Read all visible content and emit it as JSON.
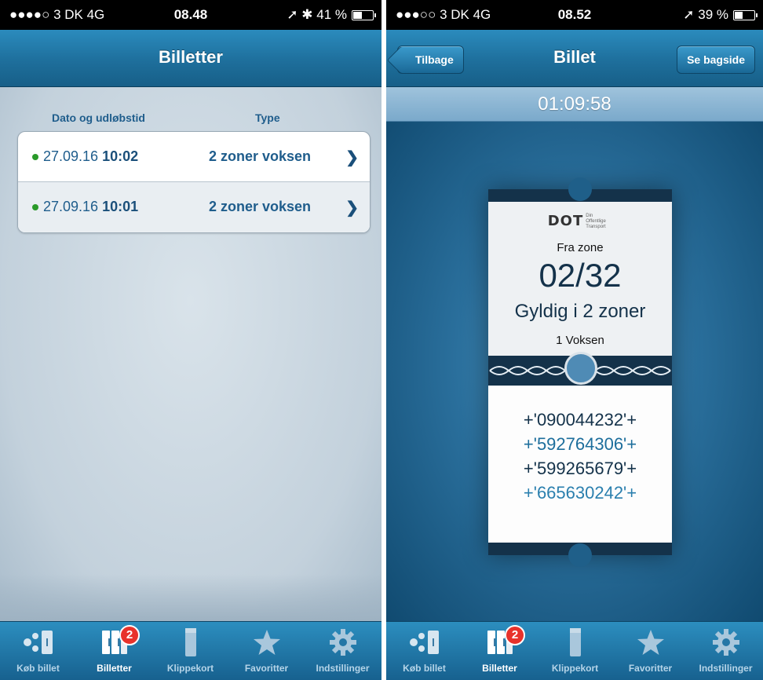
{
  "left": {
    "status": {
      "carrier": "●●●●○ 3 DK  4G",
      "time": "08.48",
      "right": "➚ ✱  41 %",
      "battery_level": 0.41
    },
    "nav": {
      "title": "Billetter"
    },
    "columns": {
      "date": "Dato og udløbstid",
      "type": "Type"
    },
    "tickets": [
      {
        "date": "27.09.16",
        "time": "10:02",
        "type": "2 zoner voksen"
      },
      {
        "date": "27.09.16",
        "time": "10:01",
        "type": "2 zoner voksen"
      }
    ]
  },
  "right": {
    "status": {
      "carrier": "●●●○○ 3 DK  4G",
      "time": "08.52",
      "right": "➚  39 %",
      "battery_level": 0.39
    },
    "nav": {
      "back": "Tilbage",
      "title": "Billet",
      "action": "Se bagside"
    },
    "timer": "01:09:58",
    "ticket": {
      "logo": "DOT",
      "logo_sub": "Din Offentlige Transport",
      "from_label": "Fra zone",
      "zone": "02/32",
      "valid": "Gyldig i 2 zoner",
      "passengers": "1 Voksen",
      "codes": [
        "+'090044232'+",
        "+'592764306'+",
        "+'599265679'+",
        "+'665630242'+"
      ]
    }
  },
  "tabs": [
    {
      "label": "Køb billet",
      "icon": "buy-ticket-icon"
    },
    {
      "label": "Billetter",
      "icon": "tickets-icon",
      "badge": "2",
      "active": true
    },
    {
      "label": "Klippekort",
      "icon": "punch-card-icon"
    },
    {
      "label": "Favoritter",
      "icon": "star-icon"
    },
    {
      "label": "Indstillinger",
      "icon": "gear-icon"
    }
  ],
  "colors": {
    "nav": "#1e6f9c",
    "accent_text": "#1f5d8c",
    "badge": "#e8322b",
    "ticket_dark": "#14324a"
  }
}
